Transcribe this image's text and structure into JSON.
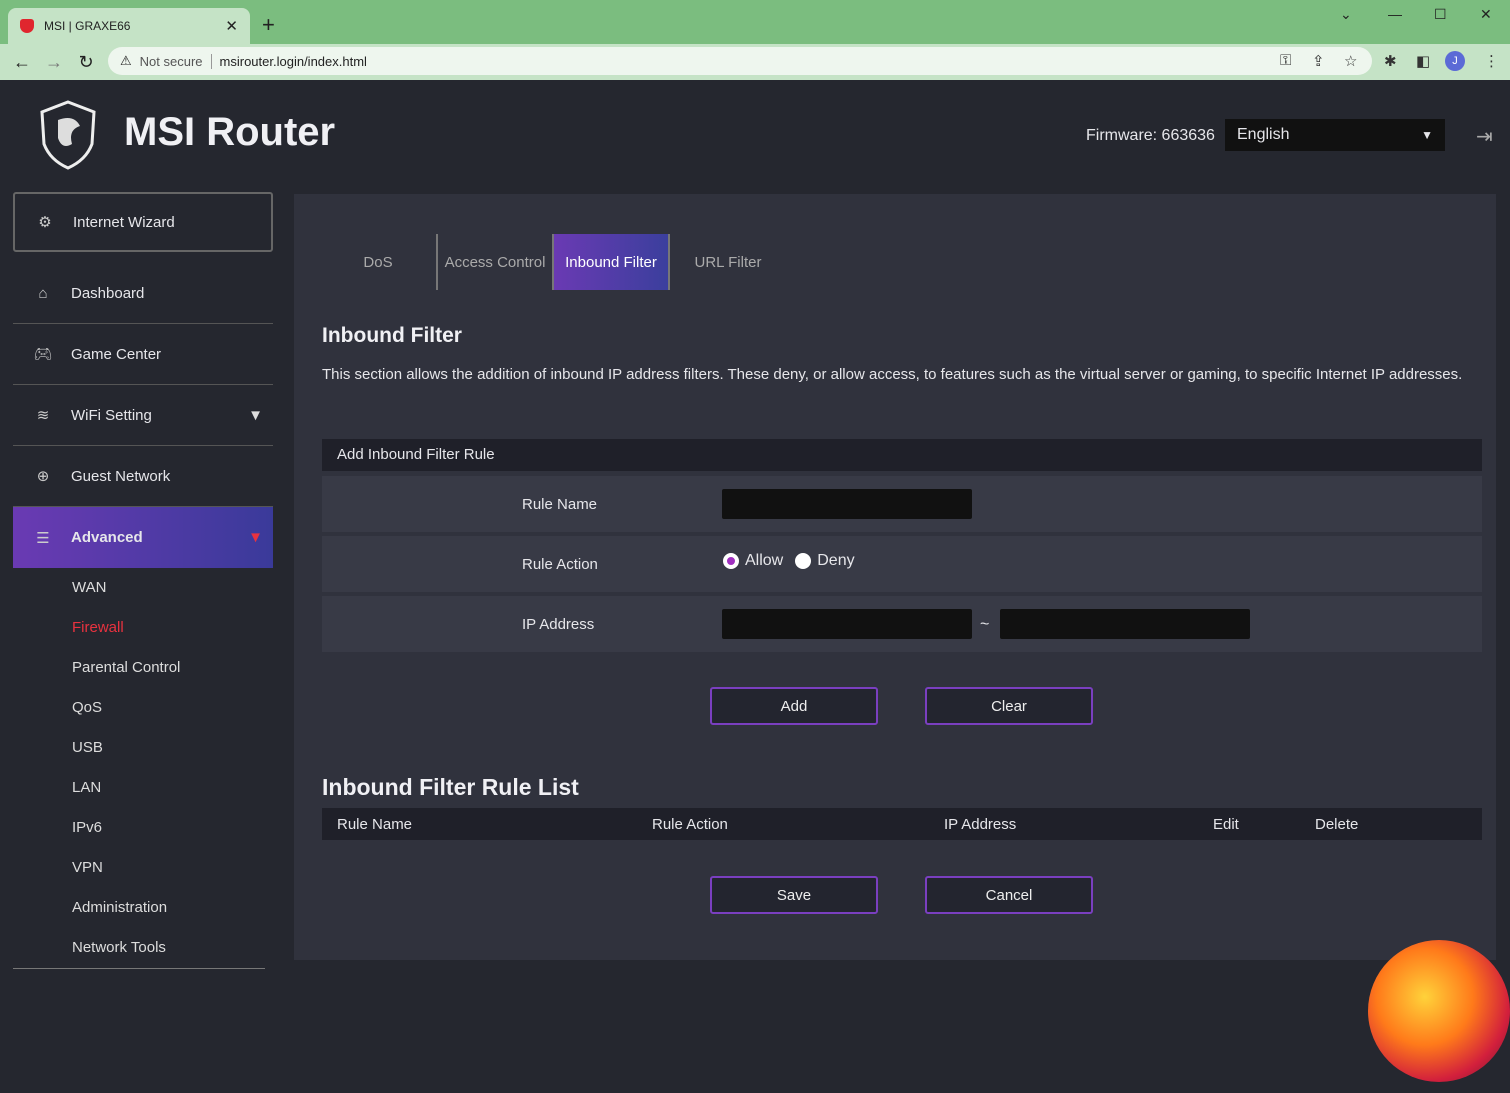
{
  "browser": {
    "tab_title": "MSI | GRAXE66",
    "not_secure": "Not secure",
    "url": "msirouter.login/index.html",
    "avatar": "J"
  },
  "header": {
    "title": "MSI Router",
    "firmware": "Firmware: 663636",
    "language": "English"
  },
  "sidebar": {
    "wizard": "Internet Wizard",
    "items": [
      {
        "label": "Dashboard",
        "icon": "home-icon"
      },
      {
        "label": "Game Center",
        "icon": "gamepad-icon"
      },
      {
        "label": "WiFi Setting",
        "icon": "wifi-icon"
      },
      {
        "label": "Guest Network",
        "icon": "globe-icon"
      },
      {
        "label": "Advanced",
        "icon": "sliders-icon"
      }
    ],
    "sub": [
      "WAN",
      "Firewall",
      "Parental Control",
      "QoS",
      "USB",
      "LAN",
      "IPv6",
      "VPN",
      "Administration",
      "Network Tools"
    ]
  },
  "tabs": [
    "DoS",
    "Access Control",
    "Inbound Filter",
    "URL Filter"
  ],
  "section": {
    "title": "Inbound Filter",
    "description": "This section allows the addition of inbound IP address filters. These deny, or allow access, to features such as the virtual server or gaming, to specific Internet IP addresses.",
    "form_title": "Add Inbound Filter Rule",
    "rule_name": "Rule Name",
    "rule_action": "Rule Action",
    "allow": "Allow",
    "deny": "Deny",
    "ip_address": "IP Address",
    "tilde": "~",
    "add": "Add",
    "clear": "Clear"
  },
  "list": {
    "title": "Inbound Filter Rule List",
    "columns": [
      "Rule Name",
      "Rule Action",
      "IP Address",
      "Edit",
      "Delete"
    ],
    "save": "Save",
    "cancel": "Cancel"
  },
  "colors": {
    "accent": "#7a3fc0",
    "active_sub": "#e8323f"
  }
}
